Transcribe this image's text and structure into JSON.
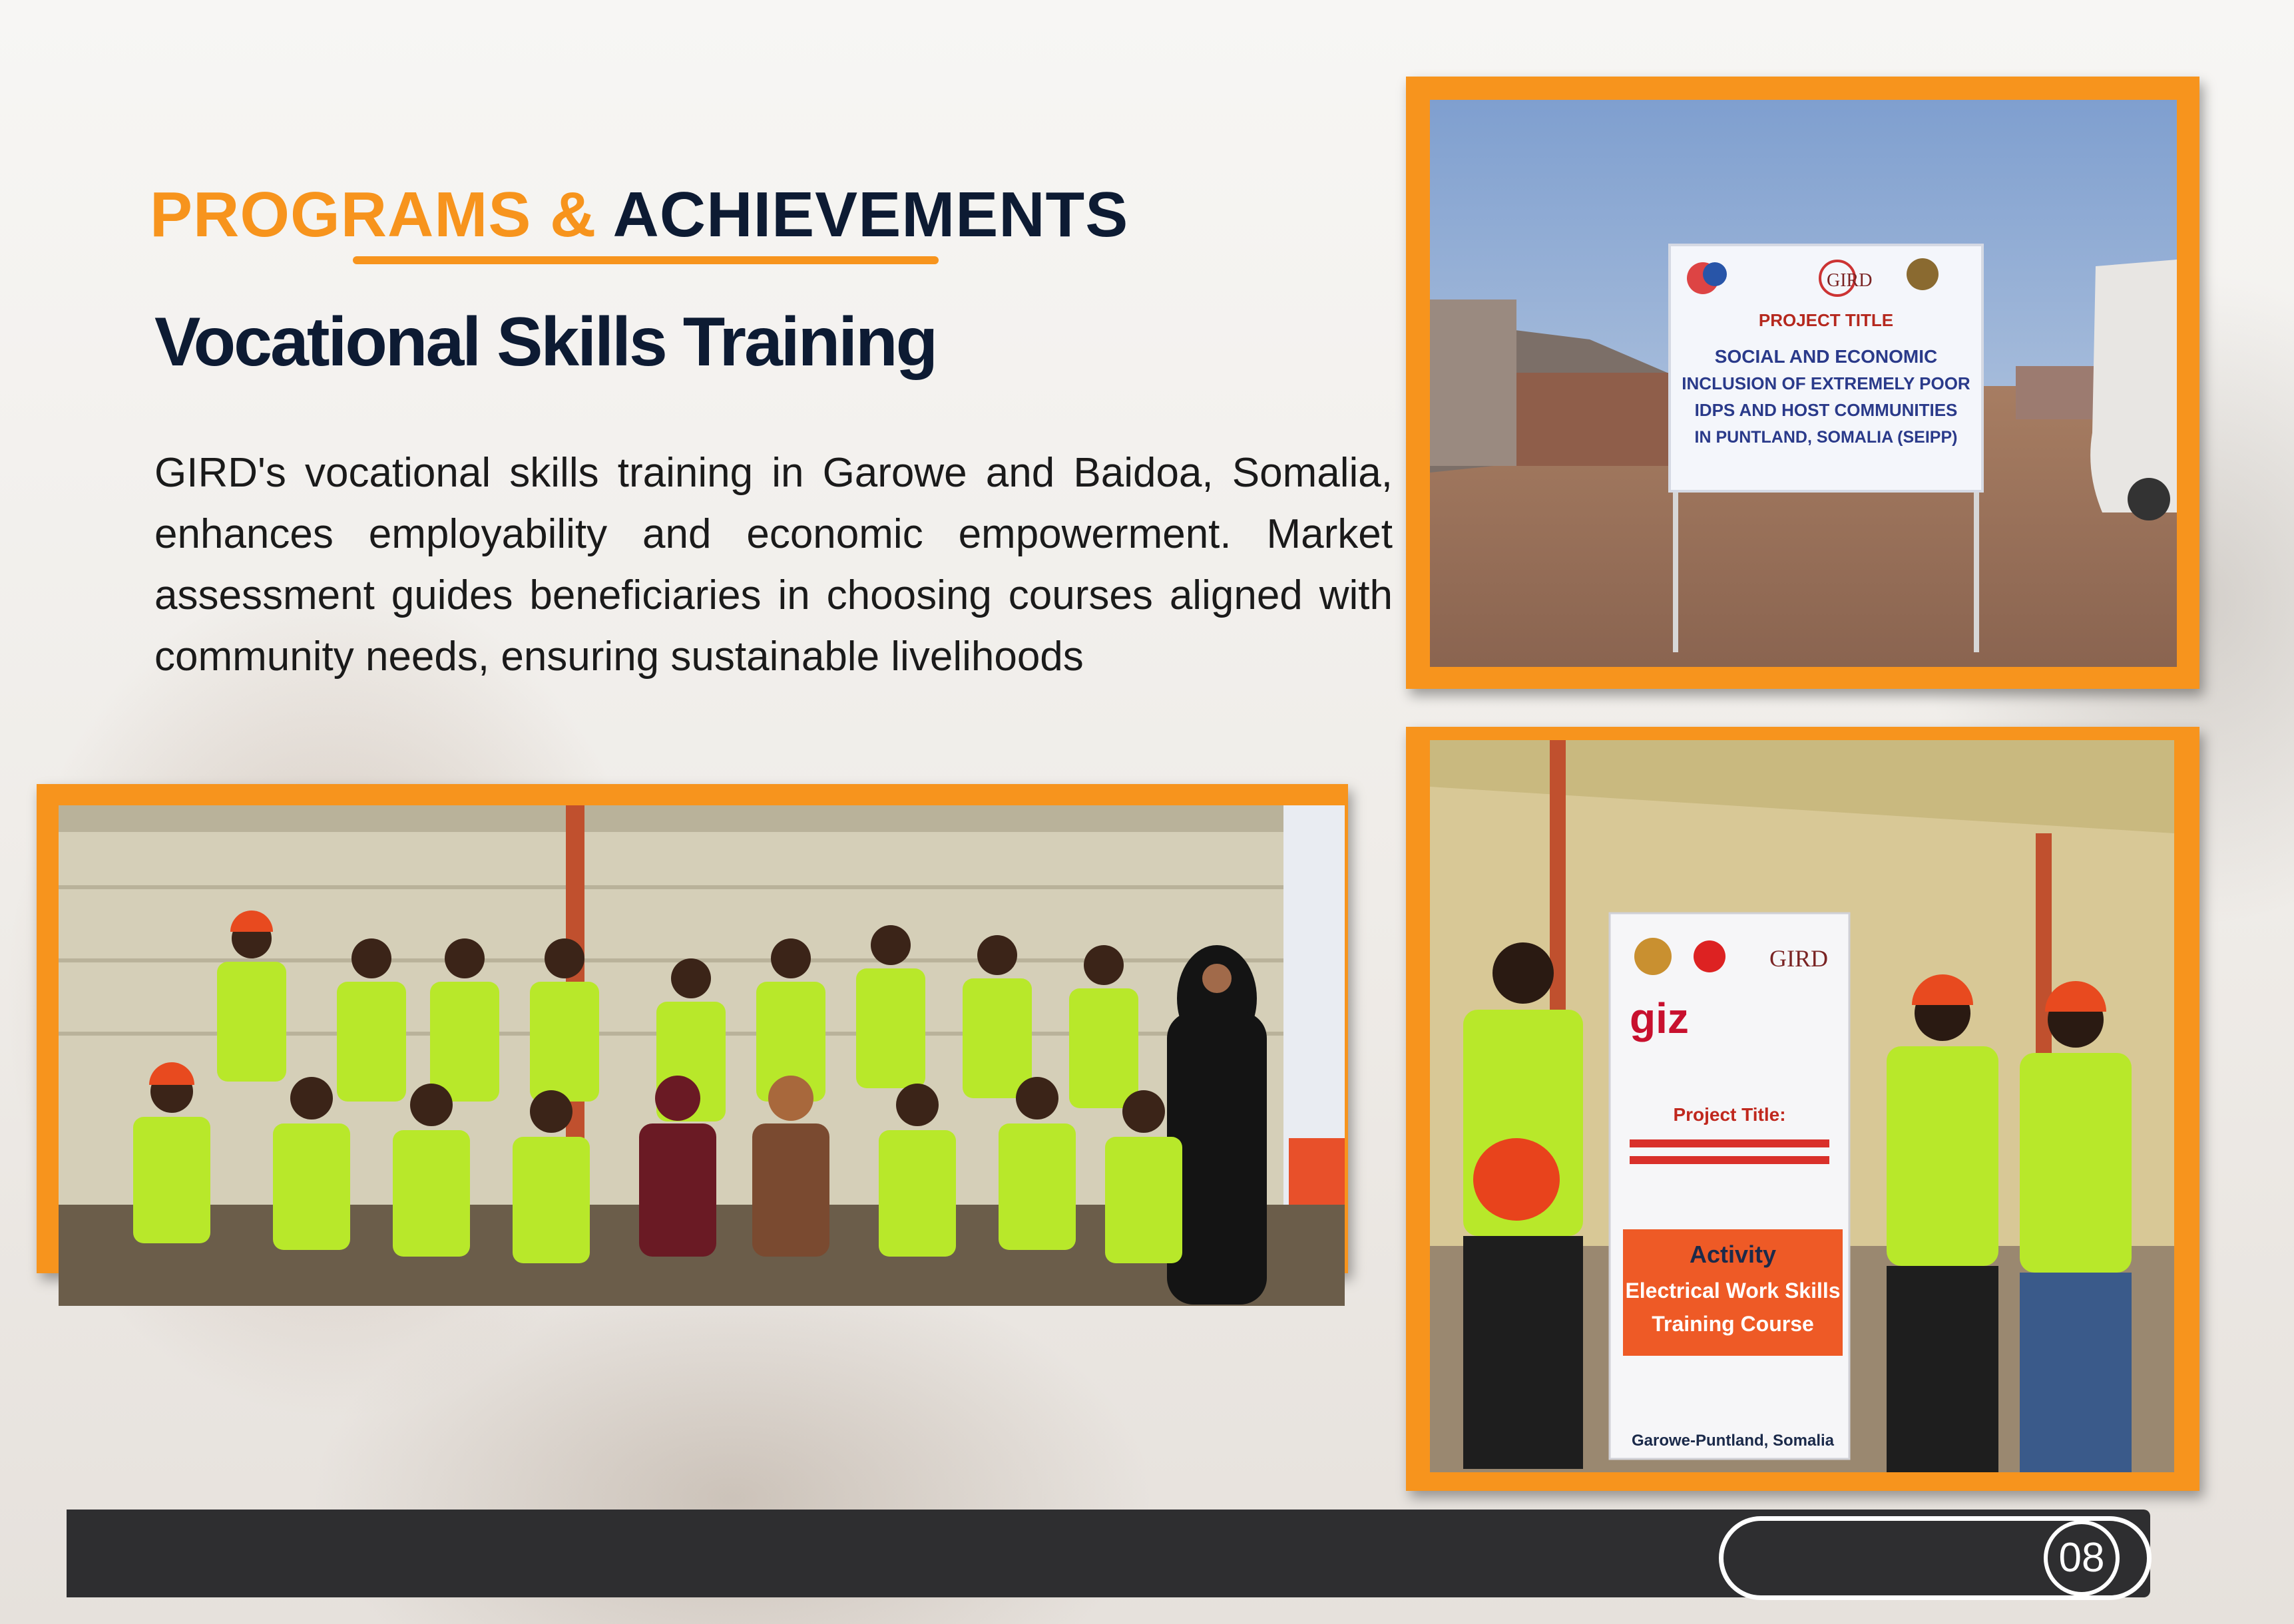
{
  "header": {
    "title_part1": "PROGRAMS &",
    "title_part2": "ACHIEVEMENTS",
    "subtitle": "Vocational Skills Training"
  },
  "body": {
    "paragraph": "GIRD's vocational skills training in Garowe and Baidoa, Somalia, enhances employability and economic empowerment. Market assessment guides beneficiaries in choosing courses aligned with community needs, ensuring sustainable livelihoods"
  },
  "photos": {
    "project_sign": {
      "logo_text": "GIRD",
      "line1": "PROJECT TITLE",
      "line2": "SOCIAL AND ECONOMIC",
      "line3": "INCLUSION OF EXTREMELY POOR",
      "line4": "IDPS AND HOST COMMUNITIES",
      "line5": "IN PUNTLAND, SOMALIA (SEIPP)"
    },
    "training_banner": {
      "giz": "giz",
      "gird": "GIRD",
      "project_title_label": "Project Title:",
      "activity_label": "Activity",
      "course_line1": "Electrical Work Skills",
      "course_line2": "Training Course",
      "location": "Garowe-Puntland, Somalia"
    }
  },
  "footer": {
    "page_number": "08"
  },
  "colors": {
    "accent_orange": "#f7941d",
    "navy": "#0d1b33",
    "footer_dark": "#2e2e30",
    "vest_green": "#b8e82a"
  }
}
